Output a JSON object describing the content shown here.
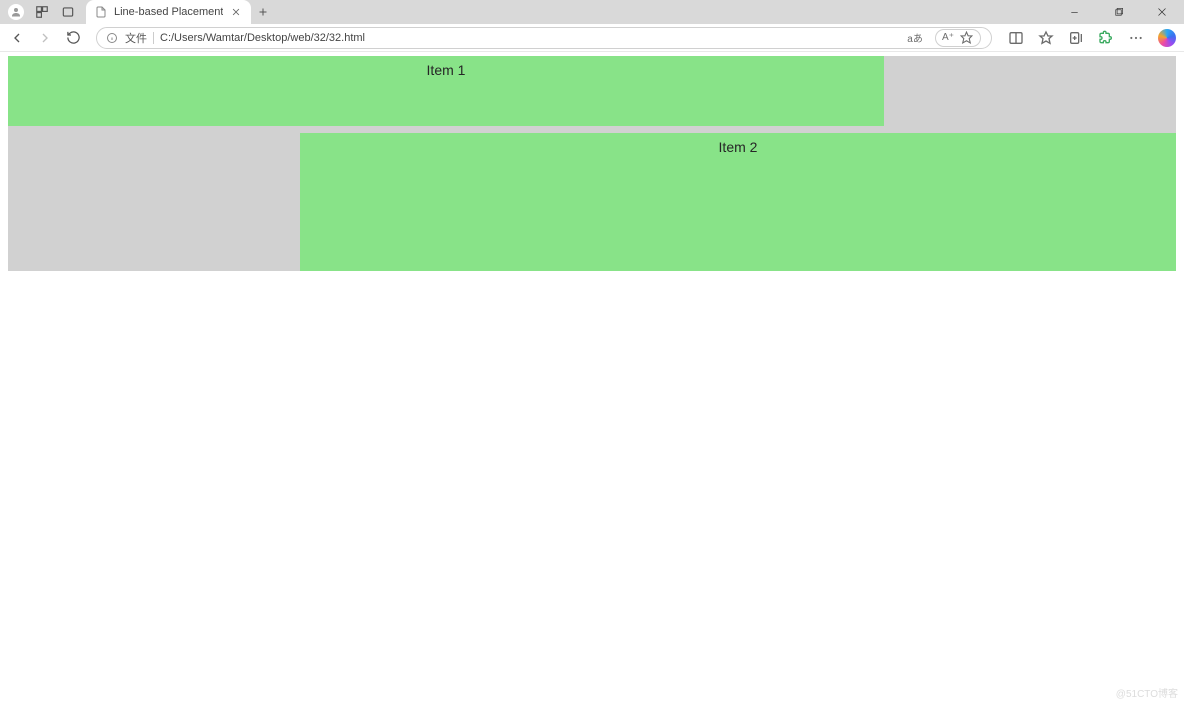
{
  "browser": {
    "tab_title": "Line-based Placement",
    "address_prefix": "文件",
    "url": "C:/Users/Wamtar/Desktop/web/32/32.html",
    "translate_label": "aあ",
    "read_aloud_label": "A⁺"
  },
  "content": {
    "item1_label": "Item 1",
    "item2_label": "Item 2"
  },
  "watermark": "@51CTO博客"
}
